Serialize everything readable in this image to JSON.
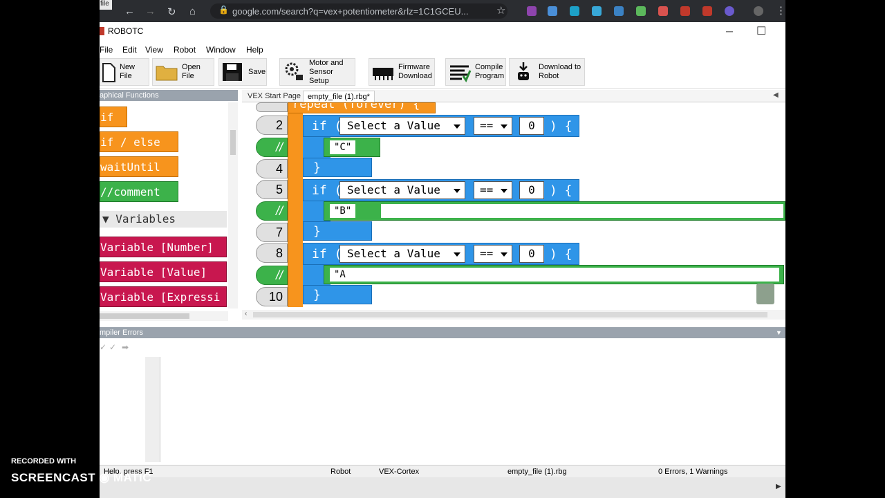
{
  "browser": {
    "url": "google.com/search?q=vex+potentiometer&rlz=1C1GCEU...",
    "file_tag": "file"
  },
  "window": {
    "title": "ROBOTC",
    "minimize": "─",
    "maximize": "☐"
  },
  "menu": [
    "File",
    "Edit",
    "View",
    "Robot",
    "Window",
    "Help"
  ],
  "toolbar": {
    "new_file": "New File",
    "open_file": "Open File",
    "save": "Save",
    "motor_setup": "Motor and\nSensor Setup",
    "firmware": "Firmware\nDownload",
    "compile": "Compile\nProgram",
    "download": "Download to\nRobot"
  },
  "palette": {
    "header": "aphical Functions",
    "blocks": {
      "if": "if",
      "if_else": "if / else",
      "wait_until": "waitUntil",
      "comment": "//comment"
    },
    "variables_header": "Variables",
    "variable_blocks": {
      "number": "Variable [Number]",
      "value": "Variable [Value]",
      "expression": "Variable [Expressi"
    }
  },
  "tabs": {
    "start_page": "VEX Start Page",
    "file": "empty_file (1).rbg*"
  },
  "code": {
    "repeat": "repeat (forever) {",
    "line_numbers": {
      "l2": "2",
      "l3": "//",
      "l4": "4",
      "l5": "5",
      "l6": "//",
      "l7": "7",
      "l8": "8",
      "l9": "//",
      "l10": "10"
    },
    "if_kw": "if (",
    "select": "Select a Value",
    "op": "==",
    "zero": "0",
    "close": ") {",
    "end_brace": "}",
    "comments": {
      "c": "\"C\"",
      "b": "\"B\"",
      "a": "\"A"
    }
  },
  "errors": {
    "header": "mpiler Errors"
  },
  "status": {
    "help": "Help, press F1",
    "robot": "Robot",
    "platform": "VEX-Cortex",
    "file": "empty_file (1).rbg",
    "errors": "0 Errors, 1 Warnings"
  },
  "watermark": {
    "line1": "RECORDED WITH",
    "line2": "SCREENCAST ◉ MATIC"
  },
  "colors": {
    "blue_block": "#2f95e8",
    "orange_block": "#f7941d",
    "green_block": "#3cb24a",
    "red_block": "#c8174f"
  }
}
